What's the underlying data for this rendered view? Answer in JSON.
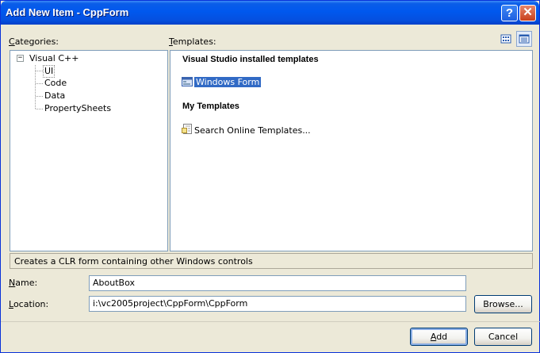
{
  "window": {
    "title": "Add New Item - CppForm",
    "help_label": "?",
    "close_label": "✕"
  },
  "labels": {
    "categories": "Categories:",
    "templates": "Templates:"
  },
  "view_buttons": {
    "large_icons": "large-icons-view-icon",
    "small_icons": "small-icons-view-icon",
    "active": "small_icons"
  },
  "categories": {
    "root": "Visual C++",
    "root_expander": "−",
    "items": [
      "UI",
      "Code",
      "Data",
      "PropertySheets"
    ],
    "selected": "UI"
  },
  "templates": {
    "installed_heading": "Visual Studio installed templates",
    "installed": [
      {
        "label": "Windows Form",
        "icon": "form-icon",
        "selected": true
      }
    ],
    "my_heading": "My Templates",
    "mine": [
      {
        "label": "Search Online Templates...",
        "icon": "search-online-icon"
      }
    ]
  },
  "description": "Creates a CLR form containing other Windows controls",
  "form": {
    "name_label": "Name:",
    "name_value": "AboutBox",
    "location_label": "Location:",
    "location_value": "i:\\vc2005project\\CppForm\\CppForm",
    "browse_label": "Browse..."
  },
  "buttons": {
    "add": "Add",
    "cancel": "Cancel"
  },
  "colors": {
    "titlebar": "#0058EE",
    "selection": "#316AC5",
    "dialog_bg": "#ECE9D8"
  }
}
